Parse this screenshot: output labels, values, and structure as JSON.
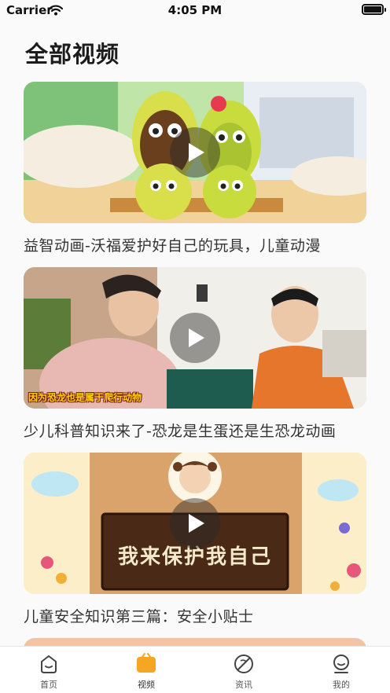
{
  "status_bar": {
    "carrier": "Carrier",
    "time": "4:05 PM"
  },
  "page": {
    "title": "全部视频"
  },
  "videos": [
    {
      "caption": "益智动画-沃福爱护好自己的玩具，儿童动漫"
    },
    {
      "caption": "少儿科普知识来了-恐龙是生蛋还是生恐龙动画",
      "overlay_text": "因为恐龙也是属于爬行动物"
    },
    {
      "caption": "儿童安全知识第三篇：安全小贴士",
      "board_text": "我来保护我自己"
    }
  ],
  "tabs": [
    {
      "label": "首页",
      "icon": "home-icon",
      "active": false
    },
    {
      "label": "视频",
      "icon": "video-icon",
      "active": true
    },
    {
      "label": "资讯",
      "icon": "news-icon",
      "active": false
    },
    {
      "label": "我的",
      "icon": "profile-icon",
      "active": false
    }
  ],
  "colors": {
    "accent": "#f5a623",
    "background": "#fafafa"
  }
}
